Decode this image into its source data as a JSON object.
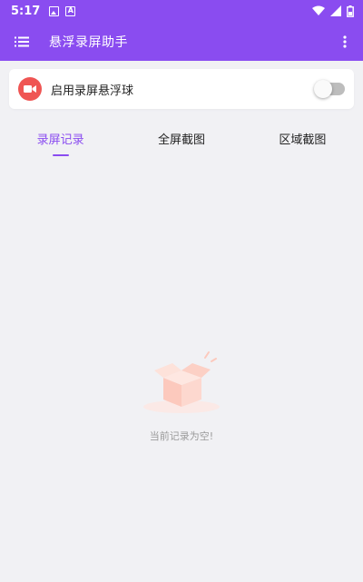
{
  "status_bar": {
    "time": "5:17",
    "left_icons": [
      "image-icon",
      "a-icon"
    ],
    "right_icons": [
      "wifi-icon",
      "signal-icon",
      "battery-icon"
    ]
  },
  "app_bar": {
    "title": "悬浮录屏助手",
    "menu_icon": "list-menu-icon",
    "more_icon": "more-vert-icon"
  },
  "float_toggle": {
    "label": "启用录屏悬浮球",
    "enabled": false,
    "icon": "video-camera-icon",
    "icon_color": "#ef5553"
  },
  "tabs": [
    {
      "label": "录屏记录",
      "active": true
    },
    {
      "label": "全屏截图",
      "active": false
    },
    {
      "label": "区域截图",
      "active": false
    }
  ],
  "empty_state": {
    "text": "当前记录为空!",
    "icon": "empty-box-icon"
  },
  "colors": {
    "accent": "#8a4cf0",
    "background": "#f1f1f4",
    "record_red": "#ef5553",
    "hint_gray": "#9b9b9b"
  }
}
